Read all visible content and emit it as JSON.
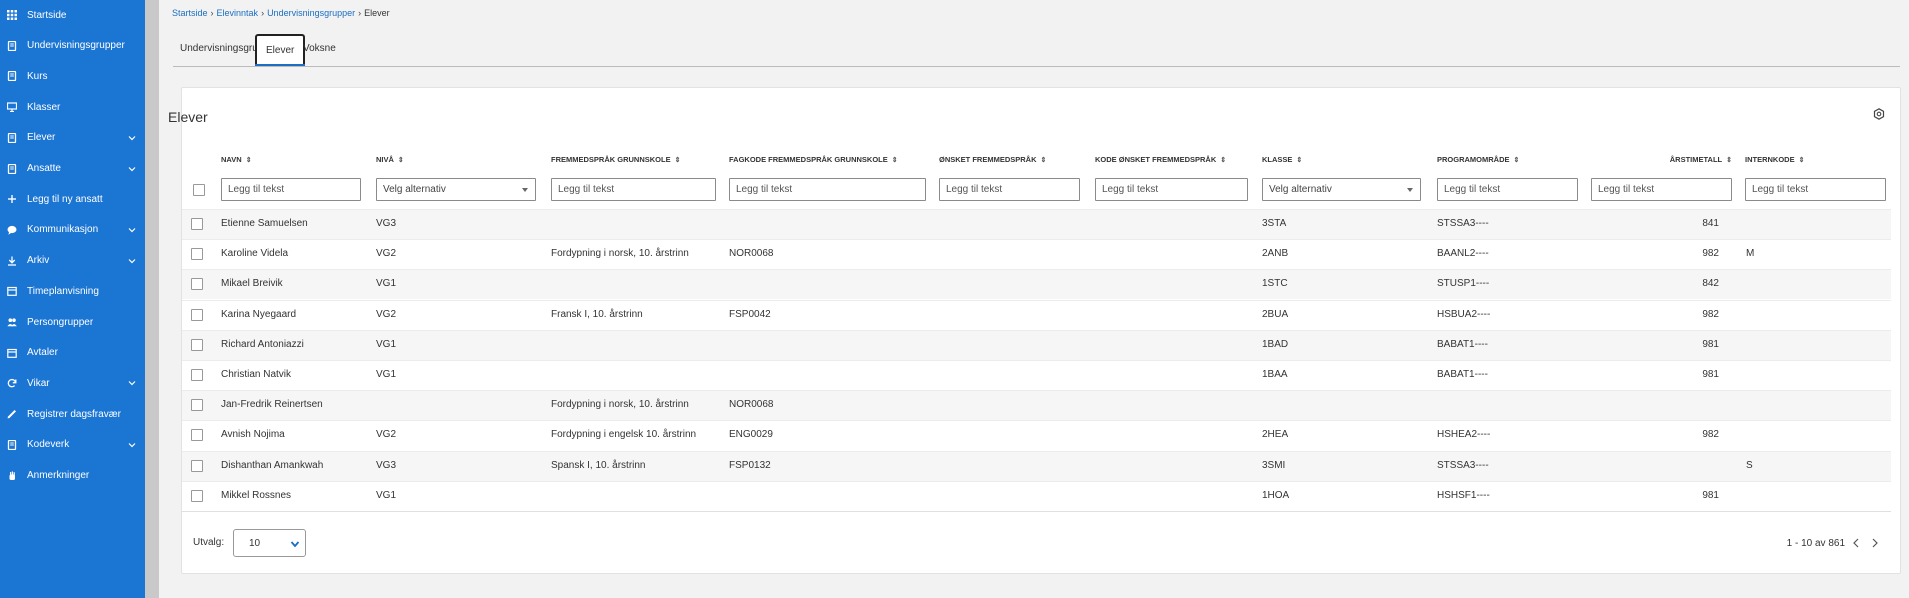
{
  "sidebar": {
    "items": [
      {
        "label": "Startside",
        "icon": "grid-icon",
        "expandable": false
      },
      {
        "label": "Undervisningsgrupper",
        "icon": "book-icon",
        "expandable": false
      },
      {
        "label": "Kurs",
        "icon": "book-icon",
        "expandable": false
      },
      {
        "label": "Klasser",
        "icon": "presentation-icon",
        "expandable": false
      },
      {
        "label": "Elever",
        "icon": "book-icon",
        "expandable": true
      },
      {
        "label": "Ansatte",
        "icon": "book-icon",
        "expandable": true
      },
      {
        "label": "Legg til ny ansatt",
        "icon": "plus-icon",
        "expandable": false
      },
      {
        "label": "Kommunikasjon",
        "icon": "chat-bubble-icon",
        "expandable": true
      },
      {
        "label": "Arkiv",
        "icon": "download-icon",
        "expandable": true
      },
      {
        "label": "Timeplanvisning",
        "icon": "calendar-icon",
        "expandable": false
      },
      {
        "label": "Persongrupper",
        "icon": "people-icon",
        "expandable": false
      },
      {
        "label": "Avtaler",
        "icon": "calendar-icon",
        "expandable": false
      },
      {
        "label": "Vikar",
        "icon": "refresh-icon",
        "expandable": true
      },
      {
        "label": "Registrer dagsfravær",
        "icon": "pencil-icon",
        "expandable": false
      },
      {
        "label": "Kodeverk",
        "icon": "book-icon",
        "expandable": true
      },
      {
        "label": "Anmerkninger",
        "icon": "hand-icon",
        "expandable": false
      }
    ]
  },
  "breadcrumb": {
    "items": [
      "Startside",
      "Elevinntak",
      "Undervisningsgrupper"
    ],
    "current": "Elever"
  },
  "tabs": [
    {
      "label": "Undervisningsgrupper",
      "active": false
    },
    {
      "label": "Elever",
      "active": true
    },
    {
      "label": "Voksne",
      "active": false
    }
  ],
  "card": {
    "title": "Elever",
    "settings_icon": "gear-icon"
  },
  "table": {
    "columns": [
      {
        "key": "navn",
        "label": "Navn",
        "filter_type": "text",
        "filter_placeholder": "Legg til tekst"
      },
      {
        "key": "niva",
        "label": "Nivå",
        "filter_type": "select",
        "filter_placeholder": "Velg alternativ"
      },
      {
        "key": "fremmedsprak",
        "label": "Fremmedspråk grunnskole",
        "filter_type": "text",
        "filter_placeholder": "Legg til tekst"
      },
      {
        "key": "fagkode",
        "label": "Fagkode fremmedspråk grunnskole",
        "filter_type": "text",
        "filter_placeholder": "Legg til tekst"
      },
      {
        "key": "onsket",
        "label": "Ønsket fremmedspråk",
        "filter_type": "text",
        "filter_placeholder": "Legg til tekst"
      },
      {
        "key": "kode_onsket",
        "label": "Kode ønsket fremmedspråk",
        "filter_type": "text",
        "filter_placeholder": "Legg til tekst"
      },
      {
        "key": "klasse",
        "label": "Klasse",
        "filter_type": "select",
        "filter_placeholder": "Velg alternativ"
      },
      {
        "key": "programomrade",
        "label": "Programområde",
        "filter_type": "text",
        "filter_placeholder": "Legg til tekst"
      },
      {
        "key": "arstimetall",
        "label": "Årstimetall",
        "filter_type": "text",
        "filter_placeholder": "Legg til tekst"
      },
      {
        "key": "internkode",
        "label": "Internkode",
        "filter_type": "text",
        "filter_placeholder": "Legg til tekst"
      }
    ],
    "rows": [
      {
        "navn": "Etienne Samuelsen",
        "niva": "VG3",
        "fremmedsprak": "",
        "fagkode": "",
        "onsket": "",
        "kode_onsket": "",
        "klasse": "3STA",
        "programomrade": "STSSA3----",
        "arstimetall": "841",
        "internkode": ""
      },
      {
        "navn": "Karoline Videla",
        "niva": "VG2",
        "fremmedsprak": "Fordypning i norsk, 10. årstrinn",
        "fagkode": "NOR0068",
        "onsket": "",
        "kode_onsket": "",
        "klasse": "2ANB",
        "programomrade": "BAANL2----",
        "arstimetall": "982",
        "internkode": "M"
      },
      {
        "navn": "Mikael Breivik",
        "niva": "VG1",
        "fremmedsprak": "",
        "fagkode": "",
        "onsket": "",
        "kode_onsket": "",
        "klasse": "1STC",
        "programomrade": "STUSP1----",
        "arstimetall": "842",
        "internkode": ""
      },
      {
        "navn": "Karina Nyegaard",
        "niva": "VG2",
        "fremmedsprak": "Fransk I, 10. årstrinn",
        "fagkode": "FSP0042",
        "onsket": "",
        "kode_onsket": "",
        "klasse": "2BUA",
        "programomrade": "HSBUA2----",
        "arstimetall": "982",
        "internkode": ""
      },
      {
        "navn": "Richard Antoniazzi",
        "niva": "VG1",
        "fremmedsprak": "",
        "fagkode": "",
        "onsket": "",
        "kode_onsket": "",
        "klasse": "1BAD",
        "programomrade": "BABAT1----",
        "arstimetall": "981",
        "internkode": ""
      },
      {
        "navn": "Christian Natvik",
        "niva": "VG1",
        "fremmedsprak": "",
        "fagkode": "",
        "onsket": "",
        "kode_onsket": "",
        "klasse": "1BAA",
        "programomrade": "BABAT1----",
        "arstimetall": "981",
        "internkode": ""
      },
      {
        "navn": "Jan-Fredrik Reinertsen",
        "niva": "",
        "fremmedsprak": "Fordypning i norsk, 10. årstrinn",
        "fagkode": "NOR0068",
        "onsket": "",
        "kode_onsket": "",
        "klasse": "",
        "programomrade": "",
        "arstimetall": "",
        "internkode": ""
      },
      {
        "navn": "Avnish Nojima",
        "niva": "VG2",
        "fremmedsprak": "Fordypning i engelsk 10. årstrinn",
        "fagkode": "ENG0029",
        "onsket": "",
        "kode_onsket": "",
        "klasse": "2HEA",
        "programomrade": "HSHEA2----",
        "arstimetall": "982",
        "internkode": ""
      },
      {
        "navn": "Dishanthan Amankwah",
        "niva": "VG3",
        "fremmedsprak": "Spansk I, 10. årstrinn",
        "fagkode": "FSP0132",
        "onsket": "",
        "kode_onsket": "",
        "klasse": "3SMI",
        "programomrade": "STSSA3----",
        "arstimetall": "",
        "internkode": "S"
      },
      {
        "navn": "Mikkel Rossnes",
        "niva": "VG1",
        "fremmedsprak": "",
        "fagkode": "",
        "onsket": "",
        "kode_onsket": "",
        "klasse": "1HOA",
        "programomrade": "HSHSF1----",
        "arstimetall": "981",
        "internkode": ""
      }
    ]
  },
  "pagination": {
    "utvalg_label": "Utvalg:",
    "page_size": "10",
    "info": "1 - 10 av 861"
  }
}
